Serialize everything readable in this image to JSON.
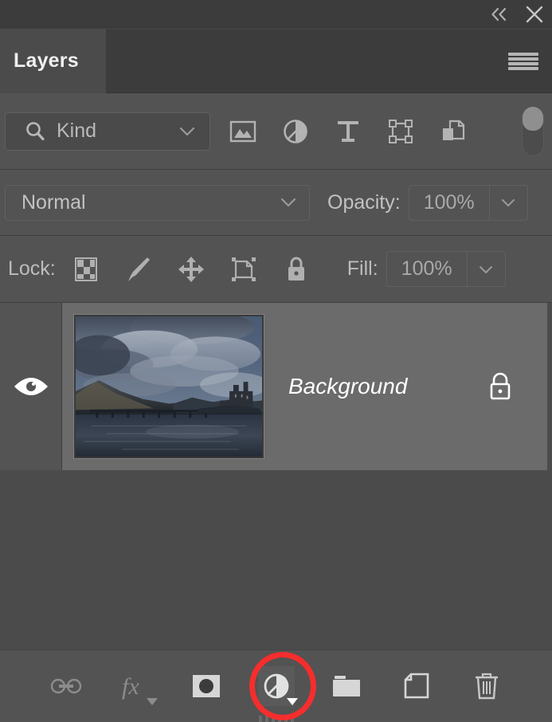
{
  "window": {
    "collapse_label": "«",
    "close_label": "✕",
    "collapse_icon": "double-chevron-left-icon",
    "close_icon": "close-icon"
  },
  "panel": {
    "tab_label": "Layers",
    "menu_icon": "hamburger-menu-icon"
  },
  "filter": {
    "search_icon": "magnifier-icon",
    "kind_value": "Kind",
    "kind_placeholder": "Kind",
    "chevron_icon": "chevron-down-icon",
    "type_filters": [
      {
        "name": "filter-pixel-layers",
        "icon": "image-icon",
        "label": "Pixel layers"
      },
      {
        "name": "filter-adjustment-layers",
        "icon": "adjustment-circle-icon",
        "label": "Adjustment layers"
      },
      {
        "name": "filter-type-layers",
        "icon": "type-t-icon",
        "label": "Type layers"
      },
      {
        "name": "filter-shape-layers",
        "icon": "shape-bounds-icon",
        "label": "Shape layers"
      },
      {
        "name": "filter-smart-objects",
        "icon": "smart-object-icon",
        "label": "Smart objects"
      }
    ],
    "toggle_icon": "filter-toggle-switch",
    "toggle_state": "off"
  },
  "blend": {
    "mode_value": "Normal",
    "mode_chevron_icon": "chevron-down-icon",
    "opacity_label": "Opacity:",
    "opacity_value": "100%",
    "opacity_chevron_icon": "chevron-down-icon"
  },
  "lock": {
    "label": "Lock:",
    "buttons": [
      {
        "name": "lock-transparent-pixels-button",
        "icon": "checkerboard-icon"
      },
      {
        "name": "lock-image-pixels-button",
        "icon": "brush-icon"
      },
      {
        "name": "lock-position-button",
        "icon": "move-arrows-icon"
      },
      {
        "name": "lock-artboard-nesting-button",
        "icon": "artboard-icon"
      },
      {
        "name": "lock-all-button",
        "icon": "padlock-icon"
      }
    ],
    "fill_label": "Fill:",
    "fill_value": "100%",
    "fill_chevron_icon": "chevron-down-icon"
  },
  "layers": [
    {
      "name": "Background",
      "visible": true,
      "locked": true,
      "selected": true,
      "visibility_icon": "eye-icon",
      "lock_icon": "padlock-icon",
      "thumbnail_description": "Dark moody landscape photo: castle and stone bridge over a loch with mountains and heavy clouds"
    }
  ],
  "bottom_bar": {
    "buttons": [
      {
        "name": "link-layers-button",
        "icon": "link-chain-icon",
        "label": "Link layers",
        "enabled": false,
        "has_caret": false
      },
      {
        "name": "layer-styles-button",
        "icon": "fx-icon",
        "label": "Add a layer style",
        "enabled": false,
        "has_caret": true
      },
      {
        "name": "add-layer-mask-button",
        "icon": "layer-mask-icon",
        "label": "Add layer mask",
        "enabled": true,
        "has_caret": false
      },
      {
        "name": "new-adjustment-layer-button",
        "icon": "adjustment-circle-icon",
        "label": "Create new fill or adjustment layer",
        "enabled": true,
        "has_caret": true,
        "highlighted": true
      },
      {
        "name": "new-group-button",
        "icon": "folder-icon",
        "label": "Create a new group",
        "enabled": true,
        "has_caret": false
      },
      {
        "name": "new-layer-button",
        "icon": "new-layer-page-icon",
        "label": "Create a new layer",
        "enabled": true,
        "has_caret": false
      },
      {
        "name": "delete-layer-button",
        "icon": "trash-icon",
        "label": "Delete layer",
        "enabled": true,
        "has_caret": false
      }
    ],
    "fx_label": "fx"
  },
  "annotation": {
    "type": "ellipse-highlight",
    "color": "#f62d2d",
    "target": "new-adjustment-layer-button"
  },
  "colors": {
    "panel_bg": "#4b4b4b",
    "header_bg": "#3c3c3c",
    "toolbar_bg": "#535353",
    "row_selected": "#6b6b6b",
    "text": "#c2c2c2",
    "text_bright": "#ffffff",
    "accent_red": "#f62d2d"
  }
}
